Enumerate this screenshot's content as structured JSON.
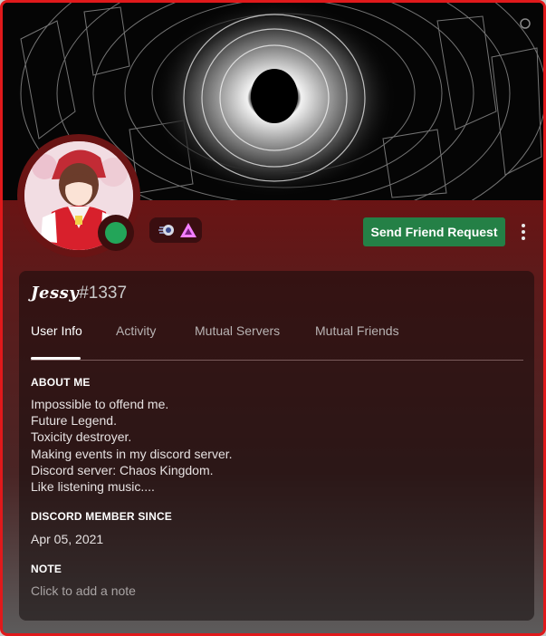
{
  "profile": {
    "display_name": "Jessy",
    "discriminator": "#1337",
    "status": "online",
    "status_color": "#23a559",
    "badges": [
      "hypesquad-icon",
      "nitro-boost-icon"
    ]
  },
  "actions": {
    "send_friend_request": "Send Friend Request",
    "more_options_icon": "more-vertical-icon"
  },
  "tabs": [
    {
      "label": "User Info",
      "active": true
    },
    {
      "label": "Activity",
      "active": false
    },
    {
      "label": "Mutual Servers",
      "active": false
    },
    {
      "label": "Mutual Friends",
      "active": false
    }
  ],
  "about": {
    "title": "ABOUT ME",
    "lines": [
      "Impossible to offend me.",
      "Future Legend.",
      "Toxicity destroyer.",
      "Making events in my discord server.",
      "Discord server: Chaos Kingdom.",
      "Like listening music...."
    ]
  },
  "member_since": {
    "title": "DISCORD MEMBER SINCE",
    "date": "Apr 05, 2021"
  },
  "note": {
    "title": "NOTE",
    "placeholder": "Click to add a note"
  },
  "colors": {
    "border": "#e0191b",
    "button": "#248046",
    "header": "#681313"
  }
}
